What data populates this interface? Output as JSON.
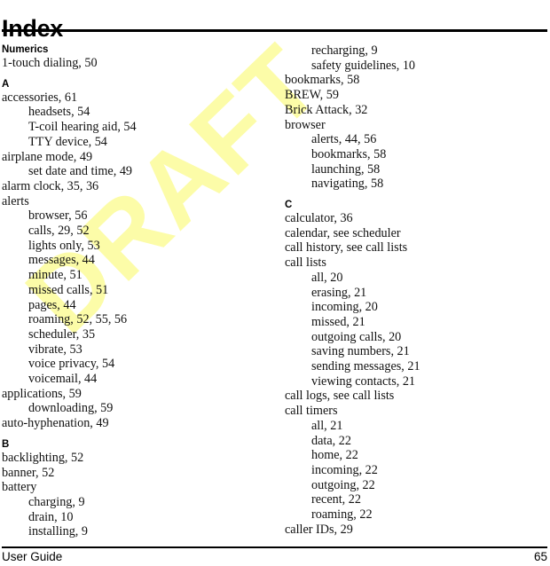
{
  "document": {
    "title": "Index",
    "watermark": "DRAFT",
    "watermark_color": "#FCFCA8"
  },
  "footer": {
    "left_label": "User Guide",
    "page_number": "65"
  },
  "columns": [
    {
      "id": "left",
      "blocks": [
        {
          "heading": "Numerics",
          "entries": [
            {
              "text": "1-touch dialing, 50",
              "level": 1
            }
          ]
        },
        {
          "heading": "A",
          "entries": [
            {
              "text": "accessories, 61",
              "level": 1
            },
            {
              "text": "headsets, 54",
              "level": 2
            },
            {
              "text": "T-coil hearing aid, 54",
              "level": 2
            },
            {
              "text": "TTY device, 54",
              "level": 2
            },
            {
              "text": "airplane mode, 49",
              "level": 1
            },
            {
              "text": "set date and time, 49",
              "level": 2
            },
            {
              "text": "alarm clock, 35, 36",
              "level": 1
            },
            {
              "text": "alerts",
              "level": 1
            },
            {
              "text": "browser, 56",
              "level": 2
            },
            {
              "text": "calls, 29, 52",
              "level": 2
            },
            {
              "text": "lights only, 53",
              "level": 2
            },
            {
              "text": "messages, 44",
              "level": 2
            },
            {
              "text": "minute, 51",
              "level": 2
            },
            {
              "text": "missed calls, 51",
              "level": 2
            },
            {
              "text": "pages, 44",
              "level": 2
            },
            {
              "text": "roaming, 52, 55, 56",
              "level": 2
            },
            {
              "text": "scheduler, 35",
              "level": 2
            },
            {
              "text": "vibrate, 53",
              "level": 2
            },
            {
              "text": "voice privacy, 54",
              "level": 2
            },
            {
              "text": "voicemail, 44",
              "level": 2
            },
            {
              "text": "applications, 59",
              "level": 1
            },
            {
              "text": "downloading, 59",
              "level": 2
            },
            {
              "text": "auto-hyphenation, 49",
              "level": 1
            }
          ]
        },
        {
          "heading": "B",
          "entries": [
            {
              "text": "backlighting, 52",
              "level": 1
            },
            {
              "text": "banner, 52",
              "level": 1
            },
            {
              "text": "battery",
              "level": 1
            },
            {
              "text": "charging, 9",
              "level": 2
            },
            {
              "text": "drain, 10",
              "level": 2
            },
            {
              "text": "installing, 9",
              "level": 2
            }
          ]
        }
      ]
    },
    {
      "id": "right",
      "blocks": [
        {
          "heading": "",
          "entries": [
            {
              "text": "recharging, 9",
              "level": 2
            },
            {
              "text": "safety guidelines, 10",
              "level": 2
            },
            {
              "text": "bookmarks, 58",
              "level": 1
            },
            {
              "text": "BREW, 59",
              "level": 1
            },
            {
              "text": "Brick Attack, 32",
              "level": 1
            },
            {
              "text": "browser",
              "level": 1
            },
            {
              "text": "alerts, 44, 56",
              "level": 2
            },
            {
              "text": "bookmarks, 58",
              "level": 2
            },
            {
              "text": "launching, 58",
              "level": 2
            },
            {
              "text": "navigating, 58",
              "level": 2
            }
          ]
        },
        {
          "heading": "C",
          "entries": [
            {
              "text": "calculator, 36",
              "level": 1
            },
            {
              "text": "calendar, see scheduler",
              "level": 1
            },
            {
              "text": "call history, see call lists",
              "level": 1
            },
            {
              "text": "call lists",
              "level": 1
            },
            {
              "text": "all, 20",
              "level": 2
            },
            {
              "text": "erasing, 21",
              "level": 2
            },
            {
              "text": "incoming, 20",
              "level": 2
            },
            {
              "text": "missed, 21",
              "level": 2
            },
            {
              "text": "outgoing calls, 20",
              "level": 2
            },
            {
              "text": "saving numbers, 21",
              "level": 2
            },
            {
              "text": "sending messages, 21",
              "level": 2
            },
            {
              "text": "viewing contacts, 21",
              "level": 2
            },
            {
              "text": "call logs, see call lists",
              "level": 1
            },
            {
              "text": "call timers",
              "level": 1
            },
            {
              "text": "all, 21",
              "level": 2
            },
            {
              "text": "data, 22",
              "level": 2
            },
            {
              "text": "home, 22",
              "level": 2
            },
            {
              "text": "incoming, 22",
              "level": 2
            },
            {
              "text": "outgoing, 22",
              "level": 2
            },
            {
              "text": "recent, 22",
              "level": 2
            },
            {
              "text": "roaming, 22",
              "level": 2
            },
            {
              "text": "caller IDs, 29",
              "level": 1
            }
          ]
        }
      ]
    }
  ]
}
